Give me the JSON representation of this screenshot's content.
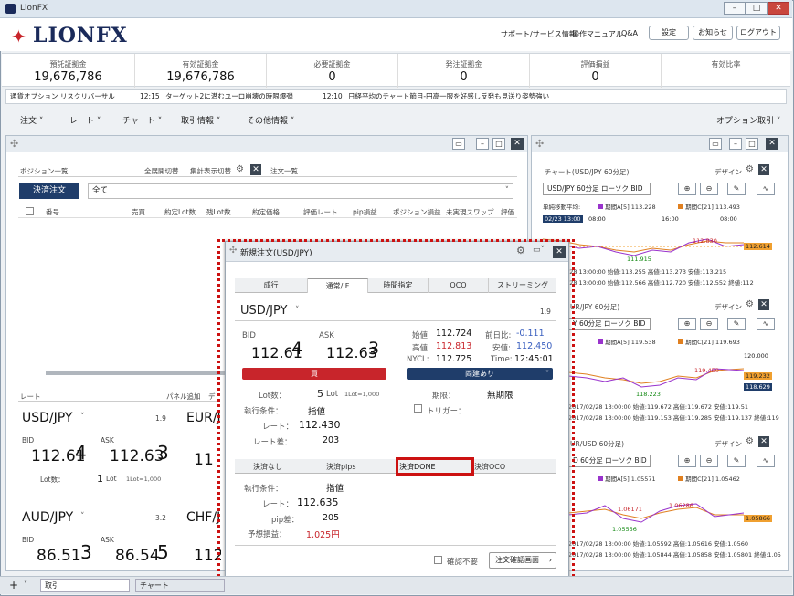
{
  "app": {
    "title": "LionFX",
    "logo": "LIONFX"
  },
  "window_controls": [
    "–",
    "□",
    "✕"
  ],
  "header_links": [
    "サポート/サービス情報",
    "操作マニュアル",
    "Q&A"
  ],
  "header_buttons": [
    "設定",
    "お知らせ",
    "ログアウト"
  ],
  "summary": [
    {
      "label": "預託証拠金",
      "value": "19,676,786"
    },
    {
      "label": "有効証拠金",
      "value": "19,676,786"
    },
    {
      "label": "必要証拠金",
      "value": "0"
    },
    {
      "label": "発注証拠金",
      "value": "0"
    },
    {
      "label": "評価損益",
      "value": "0"
    },
    {
      "label": "有効比率",
      "value": ""
    }
  ],
  "news": {
    "source": "通貨オプション リスクリバーサル",
    "items": [
      {
        "time": "12:15",
        "text": "ターゲット2に潜むユーロ崩壊の時限爆弾"
      },
      {
        "time": "12:10",
        "text": "日経平均のチャート節目-円高一服を好感し反発も見送り姿勢強い"
      }
    ]
  },
  "menu": {
    "items": [
      "注文",
      "レート",
      "チャート",
      "取引情報",
      "その他情報"
    ],
    "right": "オプション取引"
  },
  "positions": {
    "title": "ポジション一覧",
    "links": [
      "全展開切替",
      "集計表示切替"
    ],
    "tab2": "注文一覧",
    "settle_button": "決済注文",
    "filter": "全て",
    "columns": [
      "番号",
      "売買",
      "約定Lot数",
      "残Lot数",
      "約定価格",
      "評価レート",
      "pip損益",
      "ポジション損益",
      "未実現スワップ",
      "評価"
    ]
  },
  "rate_panel": {
    "title": "レート",
    "links": [
      "パネル追加",
      "デ"
    ],
    "cards": [
      {
        "pair": "USD/JPY",
        "spread": "1.9",
        "bid_label": "BID",
        "ask_label": "ASK",
        "bid_main": "112.61",
        "bid_small": "4",
        "ask_main": "112.63",
        "ask_small": "3",
        "lot_label": "Lot数：",
        "lot": "1",
        "lot_unit": "Lot",
        "lot_note": "1Lot=1,000"
      },
      {
        "pair": "EUR/J",
        "spread": "",
        "bid_main": "11",
        "ask_main": ""
      },
      {
        "pair": "AUD/JPY",
        "spread": "3.2",
        "bid_label": "BID",
        "ask_label": "ASK",
        "bid_main": "86.51",
        "bid_small": "3",
        "ask_main": "86.54",
        "ask_small": "5"
      },
      {
        "pair": "CHF/J",
        "bid_main": "112"
      }
    ]
  },
  "charts": [
    {
      "title": "チャート(USD/JPY 60分足)",
      "design": "デザイン",
      "symbol": "USD/JPY 60分足 ローソク BID",
      "ma_label": "単純移動平均:",
      "ma1": "期間A[5] 113.228",
      "ma2": "期間C[21] 113.493",
      "times": [
        "02/23 13:00",
        "08:00",
        "16:00",
        "08:00"
      ],
      "hi": "112.830",
      "lo": "111.915",
      "price": "112.614",
      "ohlc": "2017/02/28 13:00:00 始値:113.255 高値:113.273 安値:113.215",
      "ohlc2": "2017/02/28 13:00:00 始値:112.566 高値:112.720 安値:112.552 終値:112"
    },
    {
      "title": "UR/JPY 60分足)",
      "design": "デザイン",
      "symbol": "Y 60分足 ローソク BID",
      "ma1": "期間A[5] 119.538",
      "ma2": "期間C[21] 119.693",
      "levels": [
        "120.000",
        "119.232",
        "118.629"
      ],
      "hi": "119.450",
      "lo": "118.223",
      "ohlc": "2017/02/28 13:00:00 始値:119.672 高値:119.672 安値:119.51",
      "ohlc2": "2017/02/28 13:00:00 始値:119.153 高値:119.285 安値:119.137 終値:119"
    },
    {
      "title": "UR/USD 60分足)",
      "design": "デザイン",
      "symbol": "D 60分足 ローソク BID",
      "ma1": "期間A[5] 1.05571",
      "ma2": "期間C[21] 1.05462",
      "hi": "1.06286",
      "hi2": "1.06171",
      "lo": "1.05556",
      "price": "1.05866",
      "ohlc": "2017/02/28 13:00:00 始値:1.05592 高値:1.05616 安値:1.0560",
      "ohlc2": "2017/02/28 13:00:00 始値:1.05844 高値:1.05858 安値:1.05801 終値:1.05"
    }
  ],
  "order": {
    "title": "新規注文(USD/JPY)",
    "tabs": [
      "成行",
      "通常/IF",
      "時間指定",
      "OCO",
      "ストリーミング"
    ],
    "pair": "USD/JPY",
    "spread": "1.9",
    "bid_label": "BID",
    "ask_label": "ASK",
    "bid_main": "112.61",
    "bid_small": "4",
    "ask_main": "112.63",
    "ask_small": "3",
    "stats": [
      {
        "label": "始値:",
        "value": "112.724"
      },
      {
        "label": "前日比:",
        "value": "-0.111"
      },
      {
        "label": "高値:",
        "value": "112.813"
      },
      {
        "label": "安値:",
        "value": "112.450"
      },
      {
        "label": "NYCL:",
        "value": "112.725"
      },
      {
        "label": "Time:",
        "value": "12:45:01"
      }
    ],
    "buy": "買",
    "sell": "両建あり",
    "lot_label": "Lot数：",
    "lot": "5",
    "lot_unit": "Lot",
    "lot_note": "1Lot=1,000",
    "period_label": "期限：",
    "period": "無期限",
    "cond_label": "執行条件：",
    "cond": "指値",
    "trigger": "トリガー：",
    "rate_label": "レート：",
    "rate": "112.430",
    "diff_label": "レート差：",
    "diff": "203",
    "settle_tabs": [
      "決済なし",
      "決済pips",
      "決済DONE",
      "決済OCO"
    ],
    "s_cond_label": "執行条件：",
    "s_cond": "指値",
    "s_rate_label": "レート：",
    "s_rate": "112.635",
    "s_pip_label": "pip差：",
    "s_pip": "205",
    "s_pl_label": "予想損益：",
    "s_pl": "1,025円",
    "confirm": "確認不要",
    "confirm_btn": "注文確認画面"
  },
  "bottom_tabs": [
    "取引",
    "チャート"
  ],
  "colors": {
    "buy": "#c8252b",
    "sell": "#1f3d6a",
    "highlight": "#cc1111"
  }
}
